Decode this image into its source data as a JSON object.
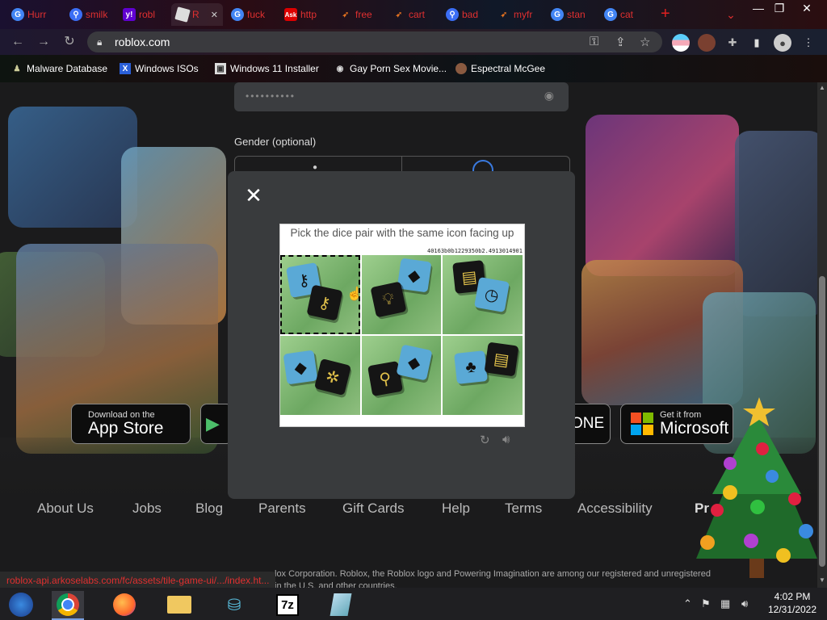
{
  "tabs": [
    {
      "label": "Hurr",
      "icon": "google-icon",
      "color": "#4285f4"
    },
    {
      "label": "smilk",
      "icon": "search-icon",
      "color": "#3b6ef5"
    },
    {
      "label": "robl",
      "icon": "yahoo-icon",
      "color": "#6001d2"
    },
    {
      "label": "R",
      "icon": "roblox-icon",
      "color": "#e0e0e0"
    },
    {
      "label": "fuck",
      "icon": "google-icon",
      "color": "#4285f4"
    },
    {
      "label": "http",
      "icon": "ask-icon",
      "color": "#d00"
    },
    {
      "label": "free",
      "icon": "rocket-icon",
      "color": "#e07020"
    },
    {
      "label": "cart",
      "icon": "rocket-icon",
      "color": "#e07020"
    },
    {
      "label": "bad",
      "icon": "search-icon",
      "color": "#3b6ef5"
    },
    {
      "label": "myfr",
      "icon": "rocket-icon",
      "color": "#e07020"
    },
    {
      "label": "stan",
      "icon": "google-icon",
      "color": "#4285f4"
    },
    {
      "label": "cat",
      "icon": "google-icon",
      "color": "#4285f4"
    }
  ],
  "omnibox": {
    "url": "roblox.com"
  },
  "bookmarks": [
    {
      "label": "Malware Database",
      "icon": "person-icon"
    },
    {
      "label": "Windows ISOs",
      "icon": "x-icon"
    },
    {
      "label": "Windows 11 Installer",
      "icon": "image-icon"
    },
    {
      "label": "Gay Porn Sex Movie...",
      "icon": "globe-icon"
    },
    {
      "label": "Espectral McGee",
      "icon": "avatar-icon"
    }
  ],
  "signup": {
    "password_mask": "••••••••••",
    "gender_label": "Gender (optional)"
  },
  "captcha": {
    "prompt": "Pick the dice pair with the same icon facing up",
    "session_id": "40163b0b1229350b2.4913014901"
  },
  "stores": {
    "apple_small": "Download on the",
    "apple_large": "App Store",
    "xbox_large": "ONE",
    "ms_small": "Get it from",
    "ms_large": "Microsoft"
  },
  "footer": {
    "links": [
      "About Us",
      "Jobs",
      "Blog",
      "Parents",
      "Gift Cards",
      "Help",
      "Terms",
      "Accessibility",
      "Pr"
    ],
    "copyright_line1": "lox Corporation. Roblox, the Roblox logo and Powering Imagination are among our registered and unregistered",
    "copyright_line2": "in the U.S. and other countries."
  },
  "status_url": "roblox-api.arkoselabs.com/fc/assets/tile-game-ui/.../index.ht...",
  "taskbar": {
    "apps": [
      "windows-start-icon",
      "chrome-icon",
      "firefox-icon",
      "file-explorer-icon",
      "network-icon",
      "7zip-icon",
      "notepad-icon"
    ],
    "zip_label": "7z",
    "time": "4:02 PM",
    "date": "12/31/2022"
  }
}
